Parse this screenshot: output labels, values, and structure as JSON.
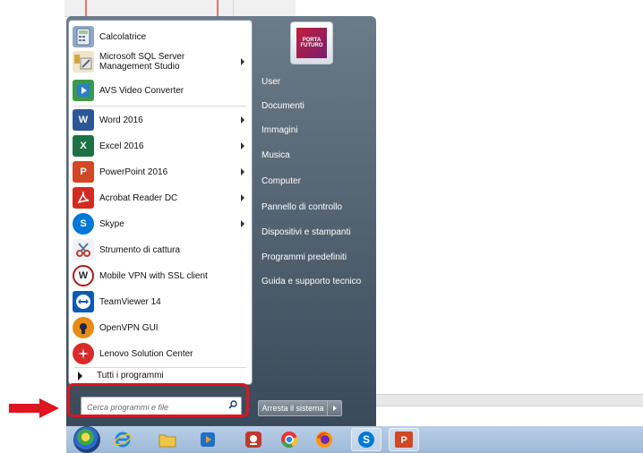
{
  "start_menu": {
    "programs": [
      {
        "label": "Calcolatrice",
        "icon": "calculator-icon",
        "has_submenu": false,
        "color": "#6d8fb5"
      },
      {
        "label": "Microsoft SQL Server Management Studio",
        "icon": "sql-server-icon",
        "has_submenu": true,
        "color": "#c49a3a"
      },
      {
        "label": "AVS Video Converter",
        "icon": "avs-video-icon",
        "has_submenu": false,
        "color": "#3a9a4a"
      },
      {
        "label": "Word 2016",
        "icon": "word-icon",
        "has_submenu": true,
        "color": "#2b5797"
      },
      {
        "label": "Excel 2016",
        "icon": "excel-icon",
        "has_submenu": true,
        "color": "#1e7145"
      },
      {
        "label": "PowerPoint 2016",
        "icon": "powerpoint-icon",
        "has_submenu": true,
        "color": "#d24726"
      },
      {
        "label": "Acrobat Reader DC",
        "icon": "acrobat-icon",
        "has_submenu": true,
        "color": "#d12b24"
      },
      {
        "label": "Skype",
        "icon": "skype-icon",
        "has_submenu": true,
        "color": "#0078d7"
      },
      {
        "label": "Strumento di cattura",
        "icon": "snipping-tool-icon",
        "has_submenu": false,
        "color": "#8a9fb8"
      },
      {
        "label": "Mobile VPN with SSL client",
        "icon": "watchguard-vpn-icon",
        "has_submenu": false,
        "color": "#b01818"
      },
      {
        "label": "TeamViewer 14",
        "icon": "teamviewer-icon",
        "has_submenu": false,
        "color": "#0e5ab3"
      },
      {
        "label": "OpenVPN GUI",
        "icon": "openvpn-icon",
        "has_submenu": false,
        "color": "#e88a14"
      },
      {
        "label": "Lenovo Solution Center",
        "icon": "lenovo-solution-icon",
        "has_submenu": false,
        "color": "#d82a2a"
      }
    ],
    "all_programs_label": "Tutti i programmi",
    "search_placeholder": "Cerca programmi e file",
    "user_picture_text": "PORTA FUTURO",
    "right_items": [
      "User",
      "Documenti",
      "Immagini",
      "Musica",
      "Computer",
      "Pannello di controllo",
      "Dispositivi e stampanti",
      "Programmi predefiniti",
      "Guida e supporto tecnico"
    ],
    "shutdown_label": "Arresta il sistema"
  },
  "taskbar": {
    "buttons": [
      {
        "icon": "windows-start-orb-icon",
        "active": false
      },
      {
        "icon": "internet-explorer-icon",
        "active": false
      },
      {
        "icon": "file-explorer-icon",
        "active": false
      },
      {
        "icon": "media-player-icon",
        "active": false
      },
      {
        "icon": "app-red-icon",
        "active": false
      },
      {
        "icon": "chrome-icon",
        "active": false
      },
      {
        "icon": "firefox-icon",
        "active": false
      },
      {
        "icon": "skype-icon",
        "active": true
      },
      {
        "icon": "powerpoint-icon",
        "active": true
      }
    ]
  },
  "colors": {
    "highlight": "#e0141e",
    "menu_dark": "#3a4a5a",
    "taskbar": "#b9cee7"
  }
}
